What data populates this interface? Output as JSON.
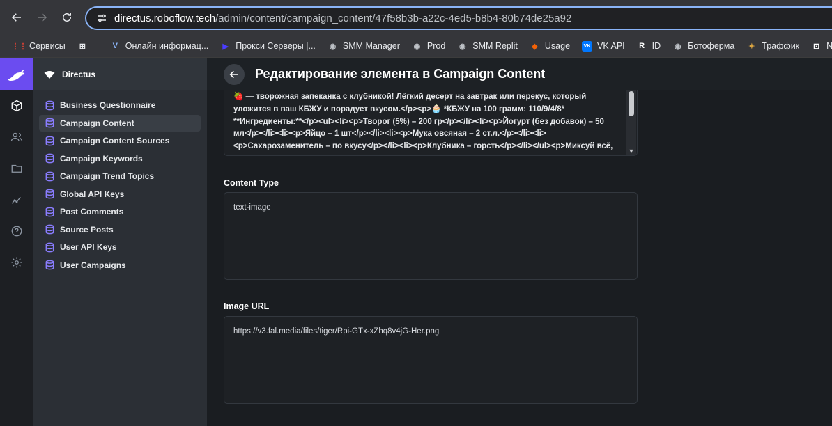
{
  "browser": {
    "url_host": "directus.roboflow.tech",
    "url_path": "/admin/content/campaign_content/47f58b3b-a22c-4ed5-b8b4-80b74de25a92",
    "bookmarks": [
      {
        "label": "Сервисы",
        "icon": "apps-grid-icon",
        "color": "#ea4335"
      },
      {
        "label": "",
        "icon": "grid-icon",
        "color": "#e8eaed"
      },
      {
        "label": "Онлайн информац...",
        "icon": "v-logo-icon",
        "color": "#8ab4f8"
      },
      {
        "label": "Прокси Серверы |...",
        "icon": "proxy-icon",
        "color": "#4a3cff"
      },
      {
        "label": "SMM Manager",
        "icon": "globe-icon",
        "color": "#bdc1c6"
      },
      {
        "label": "Prod",
        "icon": "globe-icon",
        "color": "#bdc1c6"
      },
      {
        "label": "SMM Replit",
        "icon": "globe-icon",
        "color": "#bdc1c6"
      },
      {
        "label": "Usage",
        "icon": "replit-icon",
        "color": "#f26207"
      },
      {
        "label": "VK API",
        "icon": "vk-icon",
        "color": "#0077ff"
      },
      {
        "label": "ID",
        "icon": "r-logo-icon",
        "color": "#ffffff"
      },
      {
        "label": "Ботоферма",
        "icon": "globe-icon",
        "color": "#bdc1c6"
      },
      {
        "label": "Траффик",
        "icon": "traffic-icon",
        "color": "#d9a441"
      },
      {
        "label": "NIAP | Dr",
        "icon": "niap-icon",
        "color": "#ffffff"
      }
    ]
  },
  "app": {
    "project_name": "Directus",
    "accent": "#6b4cf0"
  },
  "sidebar": {
    "items": [
      {
        "label": "Business Questionnaire",
        "active": false
      },
      {
        "label": "Campaign Content",
        "active": true
      },
      {
        "label": "Campaign Content Sources",
        "active": false
      },
      {
        "label": "Campaign Keywords",
        "active": false
      },
      {
        "label": "Campaign Trend Topics",
        "active": false
      },
      {
        "label": "Global API Keys",
        "active": false
      },
      {
        "label": "Post Comments",
        "active": false
      },
      {
        "label": "Source Posts",
        "active": false
      },
      {
        "label": "User API Keys",
        "active": false
      },
      {
        "label": "User Campaigns",
        "active": false
      }
    ]
  },
  "header": {
    "title": "Редактирование элемента в Campaign Content"
  },
  "form": {
    "content_text_lines": [
      "🍓 — творожная запеканка с клубникой! Лёгкий десерт на завтрак или перекус, который",
      "уложится в ваш КБЖУ и порадует вкусом.</p><p>🧁 *КБЖУ на 100 грамм: 110/9/4/8*",
      "**Ингредиенты:**</p><ul><li><p>Творог (5%) – 200 гр</p></li><li><p>Йогурт (без добавок) – 50",
      "мл</p></li><li><p>Яйцо – 1 шт</p></li><li><p>Мука овсяная – 2 ст.л.</p></li><li>",
      "<p>Сахарозаменитель – по вкусу</p></li><li><p>Клубника – горсть</p></li></ul><p>Миксуй всё,"
    ],
    "content_type": {
      "label": "Content Type",
      "value": "text-image"
    },
    "image_url": {
      "label": "Image URL",
      "value": "https://v3.fal.media/files/tiger/Rpi-GTx-xZhq8v4jG-Her.png"
    }
  }
}
